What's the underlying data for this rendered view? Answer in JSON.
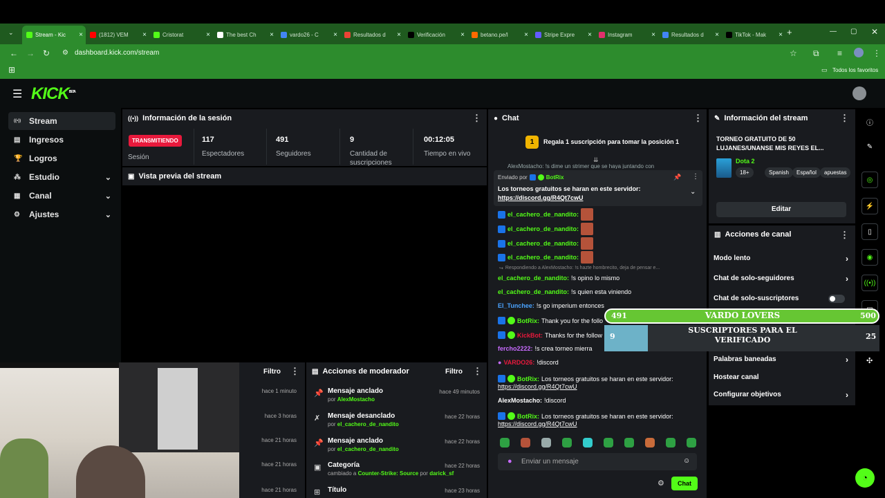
{
  "browser": {
    "tabs": [
      {
        "label": "Stream - Kic",
        "color": "#53fc18",
        "active": true
      },
      {
        "label": "(1812) VEM",
        "color": "#ff0000"
      },
      {
        "label": "Cristorat",
        "color": "#53fc18"
      },
      {
        "label": "The best Ch",
        "color": "#ffffff"
      },
      {
        "label": "vardo26 - C",
        "color": "#4285f4"
      },
      {
        "label": "Resultados d",
        "color": "#ea4335"
      },
      {
        "label": "Verificación",
        "color": "#000000"
      },
      {
        "label": "betano.pe/l",
        "color": "#ff6a00"
      },
      {
        "label": "Stripe Expre",
        "color": "#635bff"
      },
      {
        "label": "Instagram",
        "color": "#e1306c"
      },
      {
        "label": "Resultados d",
        "color": "#4285f4"
      },
      {
        "label": "TikTok - Mak",
        "color": "#000000"
      }
    ],
    "url": "dashboard.kick.com/stream",
    "bookmarks_label": "Todos los favoritos"
  },
  "kick": {
    "logo": "KICK",
    "beta": "BETA"
  },
  "sidebar": {
    "items": [
      {
        "label": "Stream",
        "icon": "broadcast-icon"
      },
      {
        "label": "Ingresos",
        "icon": "money-icon"
      },
      {
        "label": "Logros",
        "icon": "trophy-icon"
      },
      {
        "label": "Estudio",
        "icon": "studio-icon"
      },
      {
        "label": "Canal",
        "icon": "channel-icon"
      },
      {
        "label": "Ajustes",
        "icon": "gear-icon"
      }
    ]
  },
  "session": {
    "title": "Información de la sesión",
    "status": "TRANSMITIENDO",
    "status_label": "Sesión",
    "stats": [
      {
        "value": "117",
        "label": "Espectadores"
      },
      {
        "value": "491",
        "label": "Seguidores"
      },
      {
        "value": "9",
        "label": "Cantidad de suscripciones"
      },
      {
        "value": "00:12:05",
        "label": "Tiempo en vivo"
      }
    ]
  },
  "preview": {
    "title": "Vista previa del stream"
  },
  "activity": {
    "filter": "Filtro",
    "times": [
      "hace 1 minuto",
      "hace 3 horas",
      "hace 21 horas",
      "hace 21 horas",
      "hace 21 horas"
    ]
  },
  "moderator": {
    "title": "Acciones de moderador",
    "filter": "Filtro",
    "rows": [
      {
        "title": "Mensaje anclado",
        "by_prefix": "por",
        "by": "AlexMostacho",
        "time": "hace 49 minutos"
      },
      {
        "title": "Mensaje desanclado",
        "by_prefix": "por",
        "by": "el_cachero_de_nandito",
        "time": "hace 22 horas"
      },
      {
        "title": "Mensaje anclado",
        "by_prefix": "por",
        "by": "el_cachero_de_nandito",
        "time": "hace 22 horas"
      },
      {
        "title": "Categoría",
        "by_prefix": "cambiado a",
        "by": "Counter-Strike: Source",
        "by_suffix": "por",
        "by2": "darick_sf",
        "time": "hace 22 horas"
      },
      {
        "title": "Título",
        "time": "hace 23 horas"
      }
    ]
  },
  "chat": {
    "title": "Chat",
    "gift_rank": "1",
    "gift_text": "Regala 1 suscripción para tomar la posición 1",
    "cut_line": "AlexMostacho: !s dime un strimer que se haya juntando con",
    "pinned_prefix": "Enviado por",
    "pinned_user": "BotRix",
    "pinned_text": "Los torneos gratuitos se haran en este servidor:",
    "pinned_link": "https://discord.gg/R4Qt7cwU",
    "messages": [
      {
        "user": "el_cachero_de_nandito:",
        "color": "#53fc18",
        "text": "",
        "emote": true
      },
      {
        "user": "el_cachero_de_nandito:",
        "color": "#53fc18",
        "text": "",
        "emote": true
      },
      {
        "user": "el_cachero_de_nandito:",
        "color": "#53fc18",
        "text": "",
        "emote": true
      },
      {
        "user": "el_cachero_de_nandito:",
        "color": "#53fc18",
        "text": "",
        "emote": true
      }
    ],
    "reply_to": "Respondiendo a AlexMostacho: !s hazte hombrecito, deja de pensar e...",
    "msgs2": [
      {
        "user": "el_cachero_de_nandito:",
        "color": "#53fc18",
        "text": "!s opino lo mismo"
      },
      {
        "user": "el_cachero_de_nandito:",
        "color": "#53fc18",
        "text": "!s quien esta viniendo"
      },
      {
        "user": "El_Tunchee:",
        "color": "#4aa3ff",
        "text": "!s go imperium entonces"
      },
      {
        "user": "BotRix:",
        "color": "#53fc18",
        "text": "Thank you for the follo"
      },
      {
        "user": "KickBot:",
        "color": "#e8193c",
        "text": "Thanks for the follow"
      },
      {
        "user": "fercho2222:",
        "color": "#c86bff",
        "text": "!s crea torneo mierra"
      },
      {
        "user": "VARDO26:",
        "color": "#e8193c",
        "text": "!discord"
      },
      {
        "user": "BotRix:",
        "color": "#53fc18",
        "text": "Los torneos gratuitos se haran en este servidor:",
        "link": "https://discord.gg/R4Qt7cwU"
      },
      {
        "user": "AlexMostacho:",
        "color": "#ffffff",
        "text": "!discord"
      },
      {
        "user": "BotRix:",
        "color": "#53fc18",
        "text": "Los torneos gratuitos se haran en este servidor:",
        "link": "https://discord.gg/R4Qt7cwU"
      }
    ],
    "placeholder": "Enviar un mensaje",
    "send": "Chat"
  },
  "overlay": {
    "name": "VARDO LOVERS",
    "start": "491",
    "goal": "500",
    "progress": 0.45,
    "sub_text": "SUSCRIPTORES PARA EL VERIFICADO",
    "sub_count": "9",
    "sub_goal": "25"
  },
  "stream_info": {
    "title": "Información del stream",
    "stream_title": "TORNEO GRATUITO DE 50 LUJANES/UNANSE MIS REYES EL...",
    "category": "Dota 2",
    "tags": [
      "18+",
      "Spanish",
      "Español",
      "apuestas"
    ],
    "edit": "Editar"
  },
  "channel_actions": {
    "title": "Acciones de canal",
    "items": [
      {
        "label": "Modo lento",
        "type": "arrow"
      },
      {
        "label": "Chat de solo-seguidores",
        "type": "arrow"
      },
      {
        "label": "Chat de solo-suscriptores",
        "type": "toggle"
      },
      {
        "label": "Palabras baneadas",
        "type": "arrow"
      },
      {
        "label": "Hostear canal",
        "type": "none"
      },
      {
        "label": "Configurar objetivos",
        "type": "arrow"
      }
    ]
  }
}
